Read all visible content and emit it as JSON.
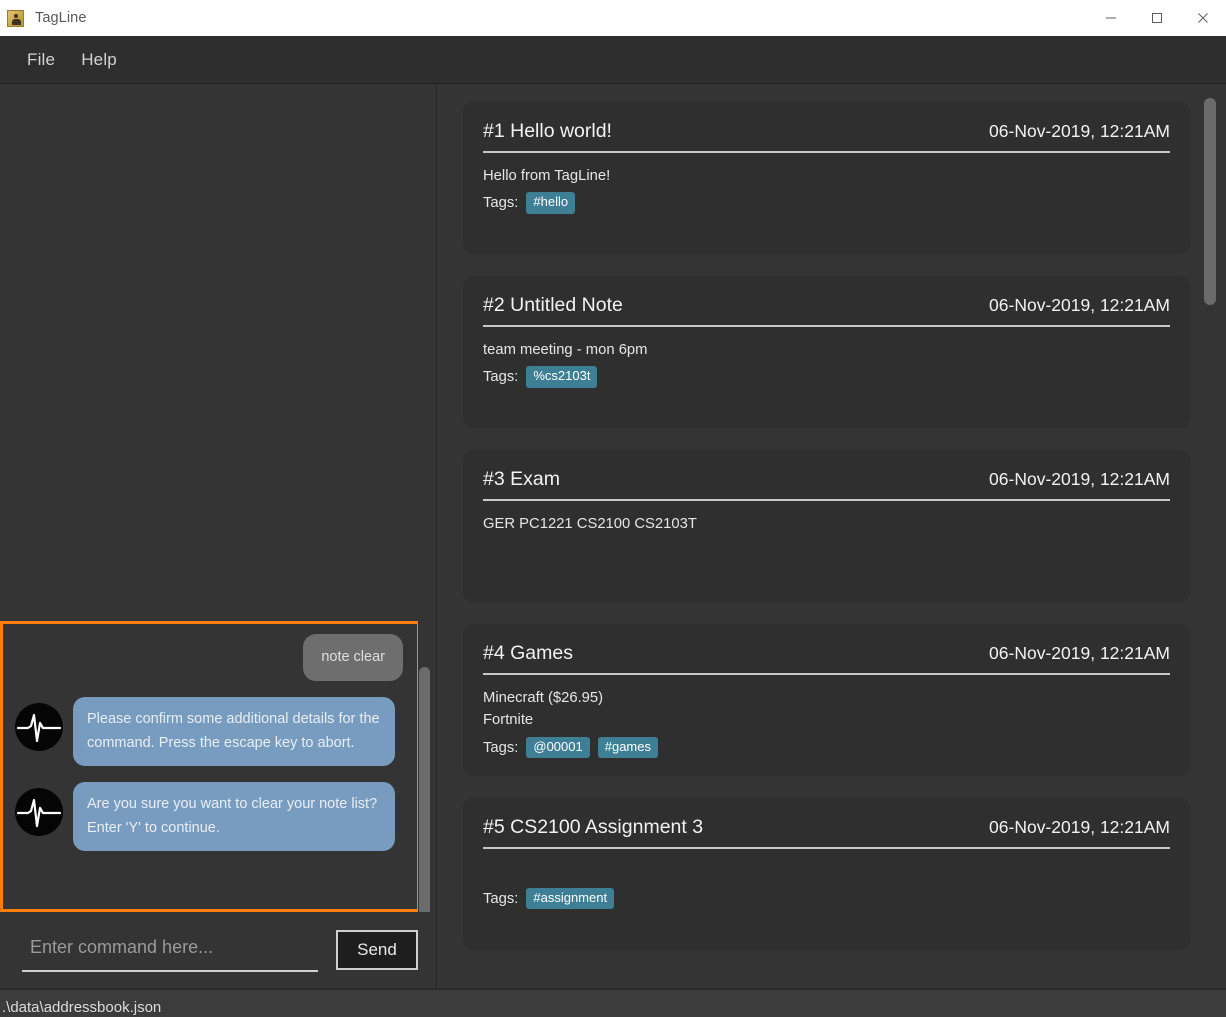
{
  "window": {
    "title": "TagLine",
    "app_icon": "person-badge-icon",
    "controls": [
      {
        "name": "minimize-button",
        "icon": "minimize-icon"
      },
      {
        "name": "maximize-button",
        "icon": "maximize-icon"
      },
      {
        "name": "close-button",
        "icon": "close-icon"
      }
    ]
  },
  "menubar": {
    "items": [
      {
        "label": "File"
      },
      {
        "label": "Help"
      }
    ]
  },
  "chat": {
    "messages": [
      {
        "sender": "user",
        "text": "note clear",
        "avatar": null
      },
      {
        "sender": "bot",
        "text": "Please confirm some additional details for the command. Press the escape key to abort.",
        "avatar": "pulse-waveform-icon"
      },
      {
        "sender": "bot",
        "text": "Are you sure you want to clear your note list? Enter 'Y' to continue.",
        "avatar": "pulse-waveform-icon"
      }
    ],
    "focus_ring_color": "#ff8000"
  },
  "command": {
    "placeholder": "Enter command here...",
    "value": "",
    "send_label": "Send"
  },
  "notes": {
    "tags_label": "Tags:",
    "items": [
      {
        "title": "#1 Hello world!",
        "date": "06-Nov-2019, 12:21AM",
        "lines": [
          "Hello from TagLine!"
        ],
        "tags": [
          "#hello"
        ]
      },
      {
        "title": "#2 Untitled Note",
        "date": "06-Nov-2019, 12:21AM",
        "lines": [
          "team meeting - mon 6pm"
        ],
        "tags": [
          "%cs2103t"
        ]
      },
      {
        "title": "#3 Exam",
        "date": "06-Nov-2019, 12:21AM",
        "lines": [
          "GER PC1221 CS2100 CS2103T"
        ],
        "tags": []
      },
      {
        "title": "#4 Games",
        "date": "06-Nov-2019, 12:21AM",
        "lines": [
          "Minecraft ($26.95)",
          "Fortnite"
        ],
        "tags": [
          "@00001",
          "#games"
        ]
      },
      {
        "title": "#5 CS2100 Assignment 3",
        "date": "06-Nov-2019, 12:21AM",
        "lines": [
          ""
        ],
        "tags": [
          "#assignment"
        ]
      }
    ]
  },
  "statusbar": {
    "path": ".\\data\\addressbook.json"
  },
  "colors": {
    "window_chrome": "#ffffff",
    "menubar": "#2e2e2e",
    "panel": "#343434",
    "card": "#2f2f2f",
    "tag_chip": "#3e7f96",
    "bot_bubble": "#779cbf",
    "user_bubble": "#6e6e6e",
    "focus_ring": "#ff8000",
    "statusbar": "#3c3c3c"
  }
}
